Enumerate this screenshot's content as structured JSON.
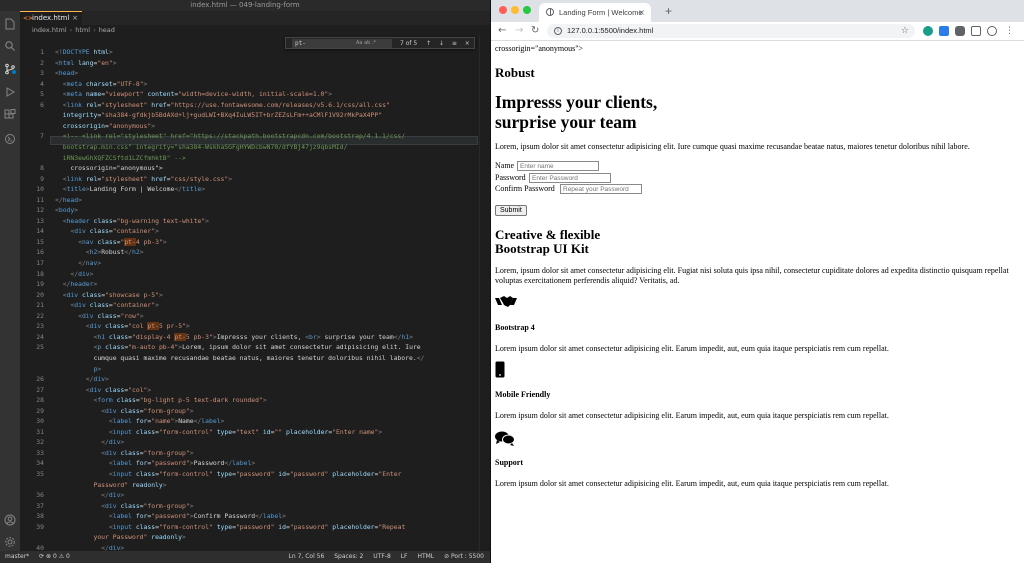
{
  "editor": {
    "window_title": "index.html — 049-landing-form",
    "tab_label": "index.html",
    "breadcrumb": [
      "index.html",
      "html",
      "head"
    ],
    "find": {
      "query": "pt-",
      "options": "Aa  ab  .*",
      "count": "7 of 5",
      "nav": "↑ ↓ ≡ ×"
    },
    "lines": [
      {
        "n": "1",
        "html": "<span class='p'>&lt;!</span><span class='t'>DOCTYPE</span> <span class='a'>html</span><span class='p'>&gt;</span>"
      },
      {
        "n": "2",
        "html": "<span class='p'>&lt;</span><span class='t'>html</span> <span class='a'>lang</span>=<span class='s'>\"en\"</span><span class='p'>&gt;</span>"
      },
      {
        "n": "3",
        "html": "<span class='p'>&lt;</span><span class='t'>head</span><span class='p'>&gt;</span>"
      },
      {
        "n": "4",
        "html": "  <span class='p'>&lt;</span><span class='t'>meta</span> <span class='a'>charset</span>=<span class='s'>\"UTF-8\"</span><span class='p'>&gt;</span>"
      },
      {
        "n": "5",
        "html": "  <span class='p'>&lt;</span><span class='t'>meta</span> <span class='a'>name</span>=<span class='s'>\"viewport\"</span> <span class='a'>content</span>=<span class='s'>\"width=device-width, initial-scale=1.0\"</span><span class='p'>&gt;</span>"
      },
      {
        "n": "6",
        "html": "  <span class='p'>&lt;</span><span class='t'>link</span> <span class='a'>rel</span>=<span class='s'>\"stylesheet\"</span> <span class='a'>href</span>=<span class='s'>\"https://use.fontawesome.com/releases/v5.6.1/css/all.css\"</span>"
      },
      {
        "n": "",
        "html": "  <span class='a'>integrity</span>=<span class='s'>\"sha384-gfdkjb5BdAXd+lj+gudLWI+BXq4IuLW5IT+brZEZsLFm++aCMlF1V92rMkPaX4PP\"</span>"
      },
      {
        "n": "",
        "html": "  <span class='a'>crossorigin</span>=<span class='s'>\"anonymous\"</span><span class='p'>&gt;</span>"
      },
      {
        "n": "7",
        "html": "  <span class='c'>&lt;!-- &lt;link rel=\"stylesheet\" href=\"https://stackpath.bootstrapcdn.com/bootstrap/4.1.1/css/</span>"
      },
      {
        "n": "",
        "html": "  <span class='c'>bootstrap.min.css\" integrity=\"sha384-WskhaSGFgHYWDcbwN70/dfYBj47jz9qbsMId/</span>"
      },
      {
        "n": "",
        "html": "  <span class='c'>iRN3ewGhXQFZCSftd1LZCfmhktB\" --&gt;</span>"
      },
      {
        "n": "8",
        "html": "    crossorigin=\"anonymous\"&gt;"
      },
      {
        "n": "9",
        "html": "  <span class='p'>&lt;</span><span class='t'>link</span> <span class='a'>rel</span>=<span class='s'>\"stylesheet\"</span> <span class='a'>href</span>=<span class='s'>\"css/style.css\"</span><span class='p'>&gt;</span>"
      },
      {
        "n": "10",
        "html": "  <span class='p'>&lt;</span><span class='t'>title</span><span class='p'>&gt;</span>Landing Form | Welcome<span class='p'>&lt;/</span><span class='t'>title</span><span class='p'>&gt;</span>"
      },
      {
        "n": "11",
        "html": "<span class='p'>&lt;/</span><span class='t'>head</span><span class='p'>&gt;</span>"
      },
      {
        "n": "12",
        "html": "<span class='p'>&lt;</span><span class='t'>body</span><span class='p'>&gt;</span>"
      },
      {
        "n": "13",
        "html": "  <span class='p'>&lt;</span><span class='t'>header</span> <span class='a'>class</span>=<span class='s'>\"bg-warning text-white\"</span><span class='p'>&gt;</span>"
      },
      {
        "n": "14",
        "html": "    <span class='p'>&lt;</span><span class='t'>div</span> <span class='a'>class</span>=<span class='s'>\"container\"</span><span class='p'>&gt;</span>"
      },
      {
        "n": "15",
        "html": "      <span class='p'>&lt;</span><span class='t'>nav</span> <span class='a'>class</span>=<span class='s'>\"<span class='m'>pt-</span>4 pb-3\"</span><span class='p'>&gt;</span>"
      },
      {
        "n": "16",
        "html": "        <span class='p'>&lt;</span><span class='t'>h2</span><span class='p'>&gt;</span>Robust<span class='p'>&lt;/</span><span class='t'>h2</span><span class='p'>&gt;</span>"
      },
      {
        "n": "17",
        "html": "      <span class='p'>&lt;/</span><span class='t'>nav</span><span class='p'>&gt;</span>"
      },
      {
        "n": "18",
        "html": "    <span class='p'>&lt;/</span><span class='t'>div</span><span class='p'>&gt;</span>"
      },
      {
        "n": "19",
        "html": "  <span class='p'>&lt;/</span><span class='t'>header</span><span class='p'>&gt;</span>"
      },
      {
        "n": "20",
        "html": "  <span class='p'>&lt;</span><span class='t'>div</span> <span class='a'>class</span>=<span class='s'>\"showcase p-5\"</span><span class='p'>&gt;</span>"
      },
      {
        "n": "21",
        "html": "    <span class='p'>&lt;</span><span class='t'>div</span> <span class='a'>class</span>=<span class='s'>\"container\"</span><span class='p'>&gt;</span>"
      },
      {
        "n": "22",
        "html": "      <span class='p'>&lt;</span><span class='t'>div</span> <span class='a'>class</span>=<span class='s'>\"row\"</span><span class='p'>&gt;</span>"
      },
      {
        "n": "23",
        "html": "        <span class='p'>&lt;</span><span class='t'>div</span> <span class='a'>class</span>=<span class='s'>\"col <span class='m'>pt-</span>5 pr-5\"</span><span class='p'>&gt;</span>"
      },
      {
        "n": "24",
        "html": "          <span class='p'>&lt;</span><span class='t'>h1</span> <span class='a'>class</span>=<span class='s'>\"display-4 <span class='m'>pt-</span>5 pb-3\"</span><span class='p'>&gt;</span>Impresss your clients, <span class='p'>&lt;</span><span class='t'>br</span><span class='p'>&gt;</span> surprise your team<span class='p'>&lt;/</span><span class='t'>h1</span><span class='p'>&gt;</span>"
      },
      {
        "n": "25",
        "html": "          <span class='p'>&lt;</span><span class='t'>p</span> <span class='a'>class</span>=<span class='s'>\"m-auto pb-4\"</span><span class='p'>&gt;</span>Lorem, ipsum dolor sit amet consectetur adipisicing elit. Iure"
      },
      {
        "n": "",
        "html": "          cumque quasi maxime recusandae beatae natus, maiores tenetur doloribus nihil labore.<span class='p'>&lt;/</span>"
      },
      {
        "n": "",
        "html": "          <span class='t'>p</span><span class='p'>&gt;</span>"
      },
      {
        "n": "26",
        "html": "        <span class='p'>&lt;/</span><span class='t'>div</span><span class='p'>&gt;</span>"
      },
      {
        "n": "27",
        "html": "        <span class='p'>&lt;</span><span class='t'>div</span> <span class='a'>class</span>=<span class='s'>\"col\"</span><span class='p'>&gt;</span>"
      },
      {
        "n": "28",
        "html": "          <span class='p'>&lt;</span><span class='t'>form</span> <span class='a'>class</span>=<span class='s'>\"bg-light p-5 text-dark rounded\"</span><span class='p'>&gt;</span>"
      },
      {
        "n": "29",
        "html": "            <span class='p'>&lt;</span><span class='t'>div</span> <span class='a'>class</span>=<span class='s'>\"form-group\"</span><span class='p'>&gt;</span>"
      },
      {
        "n": "30",
        "html": "              <span class='p'>&lt;</span><span class='t'>label</span> <span class='a'>for</span>=<span class='s'>\"name\"</span><span class='p'>&gt;</span>Name<span class='p'>&lt;/</span><span class='t'>label</span><span class='p'>&gt;</span>"
      },
      {
        "n": "31",
        "html": "              <span class='p'>&lt;</span><span class='t'>input</span> <span class='a'>class</span>=<span class='s'>\"form-control\"</span> <span class='a'>type</span>=<span class='s'>\"text\"</span> <span class='a'>id</span>=<span class='s'>\"\"</span> <span class='a'>placeholder</span>=<span class='s'>\"Enter name\"</span><span class='p'>&gt;</span>"
      },
      {
        "n": "32",
        "html": "            <span class='p'>&lt;/</span><span class='t'>div</span><span class='p'>&gt;</span>"
      },
      {
        "n": "33",
        "html": "            <span class='p'>&lt;</span><span class='t'>div</span> <span class='a'>class</span>=<span class='s'>\"form-group\"</span><span class='p'>&gt;</span>"
      },
      {
        "n": "34",
        "html": "              <span class='p'>&lt;</span><span class='t'>label</span> <span class='a'>for</span>=<span class='s'>\"password\"</span><span class='p'>&gt;</span>Password<span class='p'>&lt;/</span><span class='t'>label</span><span class='p'>&gt;</span>"
      },
      {
        "n": "35",
        "html": "              <span class='p'>&lt;</span><span class='t'>input</span> <span class='a'>class</span>=<span class='s'>\"form-control\"</span> <span class='a'>type</span>=<span class='s'>\"password\"</span> <span class='a'>id</span>=<span class='s'>\"password\"</span> <span class='a'>placeholder</span>=<span class='s'>\"Enter</span>"
      },
      {
        "n": "",
        "html": "          <span class='s'>Password\"</span> <span class='a'>readonly</span><span class='p'>&gt;</span>"
      },
      {
        "n": "36",
        "html": "            <span class='p'>&lt;/</span><span class='t'>div</span><span class='p'>&gt;</span>"
      },
      {
        "n": "37",
        "html": "            <span class='p'>&lt;</span><span class='t'>div</span> <span class='a'>class</span>=<span class='s'>\"form-group\"</span><span class='p'>&gt;</span>"
      },
      {
        "n": "38",
        "html": "              <span class='p'>&lt;</span><span class='t'>label</span> <span class='a'>for</span>=<span class='s'>\"password\"</span><span class='p'>&gt;</span>Confirm Password<span class='p'>&lt;/</span><span class='t'>label</span><span class='p'>&gt;</span>"
      },
      {
        "n": "39",
        "html": "              <span class='p'>&lt;</span><span class='t'>input</span> <span class='a'>class</span>=<span class='s'>\"form-control\"</span> <span class='a'>type</span>=<span class='s'>\"password\"</span> <span class='a'>id</span>=<span class='s'>\"password\"</span> <span class='a'>placeholder</span>=<span class='s'>\"Repeat</span>"
      },
      {
        "n": "",
        "html": "          <span class='s'>your Password\"</span> <span class='a'>readonly</span><span class='p'>&gt;</span>"
      },
      {
        "n": "40",
        "html": "            <span class='p'>&lt;/</span><span class='t'>div</span><span class='p'>&gt;</span>"
      }
    ],
    "status": {
      "branch": "master*",
      "sync": "⟳ ⊗ 0 ⚠ 0",
      "position": "Ln 7, Col 56",
      "spaces": "Spaces: 2",
      "encoding": "UTF-8",
      "eol": "LF",
      "language": "HTML",
      "port": "⊘ Port : 5500"
    }
  },
  "browser": {
    "tab_title": "Landing Form | Welcome",
    "url": "127.0.0.1:5500/index.html",
    "page": {
      "stray_text": "crossorigin=\"anonymous\">",
      "brand": "Robust",
      "headline_line1": "Impresss your clients,",
      "headline_line2": "surprise your team",
      "intro": "Lorem, ipsum dolor sit amet consectetur adipisicing elit. Iure cumque quasi maxime recusandae beatae natus, maiores tenetur doloribus nihil labore.",
      "form": {
        "name_label": "Name",
        "name_placeholder": "Enter name",
        "password_label": "Password",
        "password_placeholder": "Enter Password",
        "confirm_label": "Confirm Password",
        "confirm_placeholder": "Repeat your Password",
        "submit": "Submit"
      },
      "section_title_line1": "Creative & flexible",
      "section_title_line2": "Bootstrap UI Kit",
      "section_text": "Lorem, ipsum dolor sit amet consectetur adipisicing elit. Fugiat nisi soluta quis ipsa nihil, consectetur cupiditate dolores ad expedita distinctio quisquam repellat voluptas exercitationem perferendis aliquid? Veritatis, ad.",
      "features": [
        {
          "icon": "handshake-icon",
          "title": "Bootstrap 4",
          "text": "Lorem ipsum dolor sit amet consectetur adipisicing elit. Earum impedit, aut, eum quia itaque perspiciatis rem cum repellat."
        },
        {
          "icon": "mobile-phone-icon",
          "title": "Mobile Friendly",
          "text": "Lorem ipsum dolor sit amet consectetur adipisicing elit. Earum impedit, aut, eum quia itaque perspiciatis rem cum repellat."
        },
        {
          "icon": "comments-icon",
          "title": "Support",
          "text": "Lorem ipsum dolor sit amet consectetur adipisicing elit. Earum impedit, aut, eum quia itaque perspiciatis rem cum repellat."
        }
      ]
    }
  },
  "colors": {
    "editor_bg": "#1e1e1e",
    "activity_bar": "#333333",
    "status_bar": "#2e2e2e",
    "tag": "#569cd6",
    "attribute": "#9cdcfe",
    "string": "#ce9178",
    "comment": "#6a9955",
    "mac_close": "#ff5f57",
    "mac_min": "#febc2e",
    "mac_max": "#28c840"
  }
}
